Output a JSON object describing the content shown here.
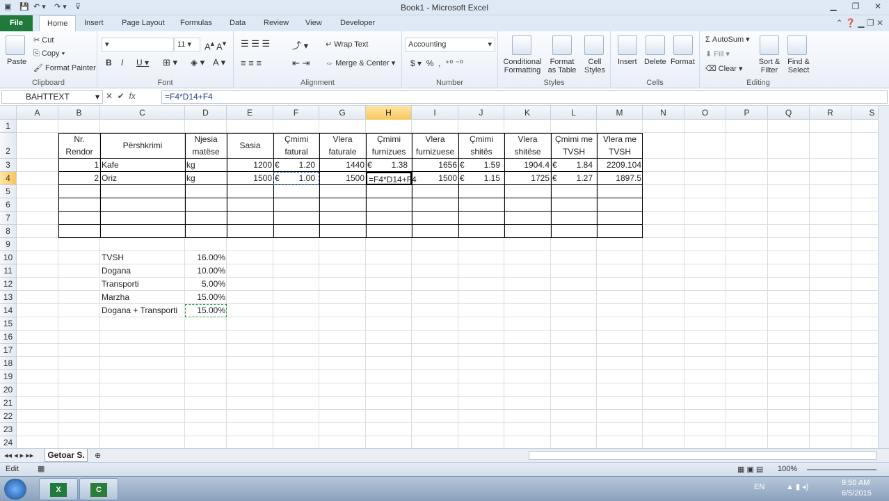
{
  "window": {
    "title": "Book1 - Microsoft Excel"
  },
  "tabs": [
    "File",
    "Home",
    "Insert",
    "Page Layout",
    "Formulas",
    "Data",
    "Review",
    "View",
    "Developer"
  ],
  "ribbon": {
    "clipboard": {
      "paste": "Paste",
      "cut": "Cut",
      "copy": "Copy",
      "format_painter": "Format Painter",
      "label": "Clipboard"
    },
    "font": {
      "size": "11",
      "label": "Font"
    },
    "alignment": {
      "wrap": "Wrap Text",
      "merge": "Merge & Center",
      "label": "Alignment"
    },
    "number": {
      "format": "Accounting",
      "label": "Number"
    },
    "styles": {
      "conditional": [
        "Conditional",
        "Formatting"
      ],
      "format_table": [
        "Format",
        "as Table"
      ],
      "cell_styles": [
        "Cell",
        "Styles"
      ],
      "label": "Styles"
    },
    "cells": {
      "insert": "Insert",
      "delete": "Delete",
      "format": "Format",
      "label": "Cells"
    },
    "editing": {
      "autosum": "AutoSum",
      "fill": "Fill",
      "clear": "Clear",
      "sort": [
        "Sort &",
        "Filter"
      ],
      "find": [
        "Find &",
        "Select"
      ],
      "label": "Editing"
    }
  },
  "formula_bar": {
    "name_box": "BAHTTEXT",
    "formula": "=F4*D14+F4"
  },
  "columns": [
    "A",
    "B",
    "C",
    "D",
    "E",
    "F",
    "G",
    "H",
    "I",
    "J",
    "K",
    "L",
    "M",
    "N",
    "O",
    "P",
    "Q",
    "R",
    "S"
  ],
  "rows": [
    "1",
    "2",
    "3",
    "4",
    "5",
    "6",
    "7",
    "8",
    "9",
    "10",
    "11",
    "12",
    "13",
    "14",
    "15",
    "16",
    "17",
    "18",
    "19",
    "20",
    "21",
    "22",
    "23",
    "24"
  ],
  "table": {
    "headers": [
      [
        "Nr.",
        "Rendor"
      ],
      [
        "Përshkrimi"
      ],
      [
        "Njesia",
        "matëse"
      ],
      [
        "Sasia"
      ],
      [
        "Çmimi",
        "fatural"
      ],
      [
        "Vlera",
        "faturale"
      ],
      [
        "Çmimi",
        "furnizues"
      ],
      [
        "Vlera",
        "furnizuese"
      ],
      [
        "Çmimi",
        "shitës"
      ],
      [
        "Vlera",
        "shitëse"
      ],
      [
        "Çmimi me",
        "TVSH"
      ],
      [
        "Vlera me",
        "TVSH"
      ]
    ],
    "rows": [
      [
        "1",
        "Kafe",
        "kg",
        "1200",
        "€",
        "1.20",
        "1440",
        "€",
        "1.38",
        "1656",
        "€",
        "1.59",
        "1904.4",
        "€",
        "1.84",
        "2209.104"
      ],
      [
        "2",
        "Oriz",
        "kg",
        "1500",
        "€",
        "1.00",
        "1500",
        "=F4*D14+F4",
        "",
        "1500",
        "€",
        "1.15",
        "1725",
        "€",
        "1.27",
        "1897.5"
      ]
    ]
  },
  "params": [
    {
      "label": "TVSH",
      "value": "16.00%"
    },
    {
      "label": "Dogana",
      "value": "10.00%"
    },
    {
      "label": "Transporti",
      "value": "5.00%"
    },
    {
      "label": "Marzha",
      "value": "15.00%"
    },
    {
      "label": "Dogana + Transporti",
      "value": "15.00%"
    }
  ],
  "sheet_tab": "Getoar S.",
  "status": {
    "mode": "Edit",
    "zoom": "100%"
  },
  "taskbar": {
    "lang": "EN",
    "time": "9:50 AM",
    "date": "6/5/2015"
  }
}
